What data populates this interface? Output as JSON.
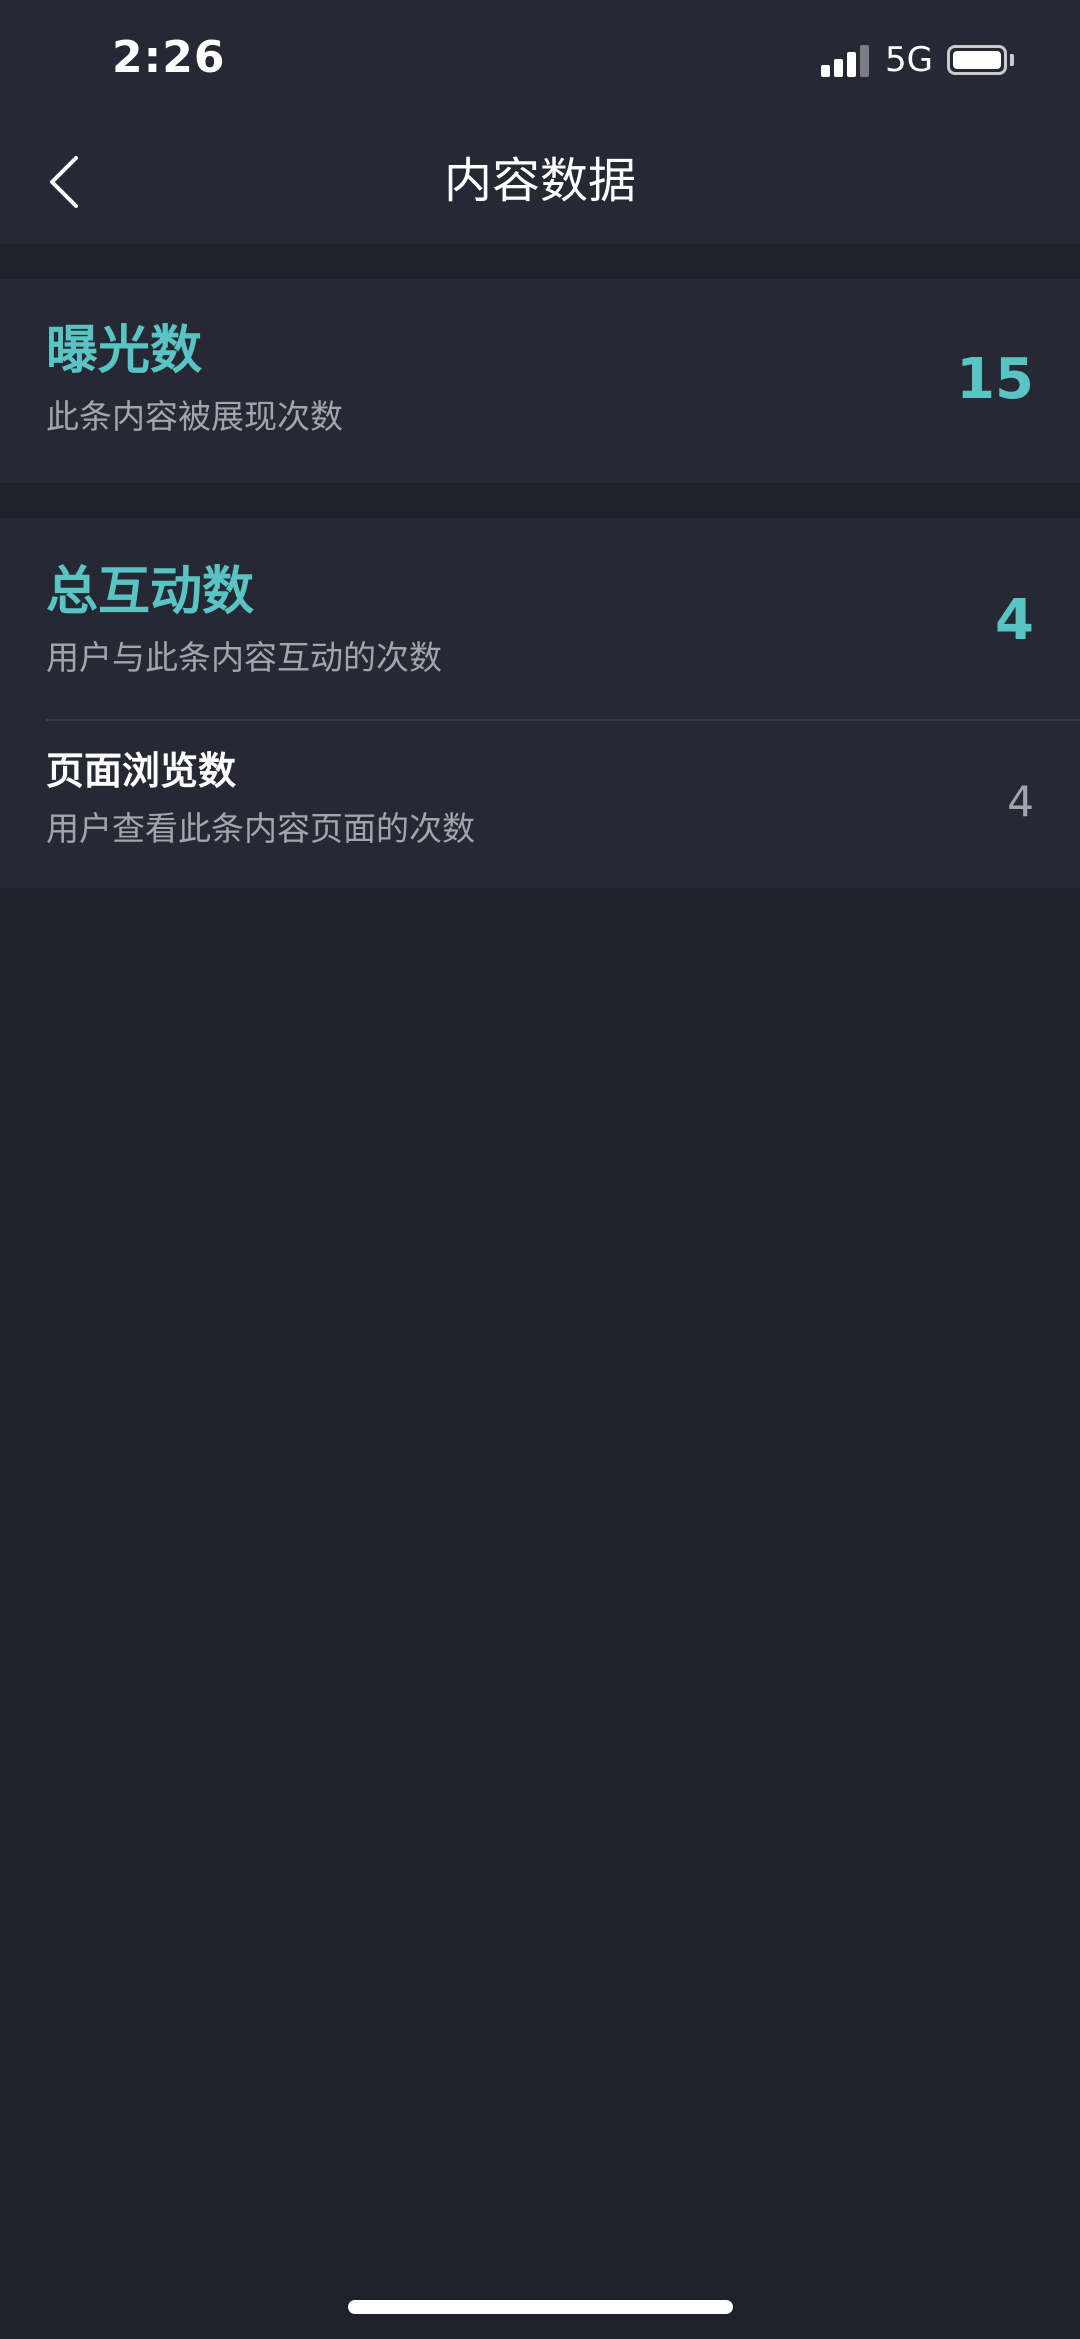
{
  "status_bar": {
    "time": "2:26",
    "network": "5G",
    "battery_level": 1.0
  },
  "nav": {
    "back_icon": "chevron-left-icon",
    "title": "内容数据"
  },
  "exposure": {
    "title": "曝光数",
    "description": "此条内容被展现次数",
    "value": "15"
  },
  "interactions": {
    "title": "总互动数",
    "description": "用户与此条内容互动的次数",
    "value": "4",
    "items": [
      {
        "title": "页面浏览数",
        "description": "用户查看此条内容页面的次数",
        "value": "4"
      }
    ]
  },
  "colors": {
    "accent": "#5ac3c3",
    "background": "#1f212a",
    "card": "#262833",
    "secondary_text": "#a3a5ad"
  }
}
